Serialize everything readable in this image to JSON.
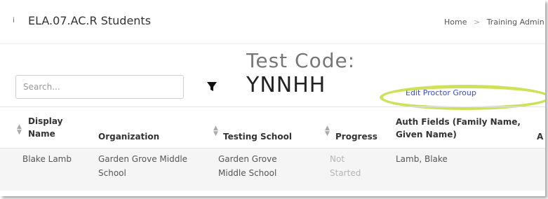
{
  "header": {
    "left_stub": "i",
    "title": "ELA.07.AC.R Students",
    "breadcrumb": [
      "Home",
      "Training Admin"
    ]
  },
  "toolbar": {
    "search_placeholder": "Search...",
    "filter_icon": "filter-icon",
    "test_code_label": "Test Code:",
    "test_code_value": "YNNHH",
    "edit_proctor_group_link": "Edit Proctor Group",
    "highlight_color": "#c6dc3a"
  },
  "table": {
    "columns": [
      "Display Name",
      "Organization",
      "Testing School",
      "Progress",
      "Auth Fields (Family Name, Given Name)",
      "A"
    ],
    "rows": [
      {
        "display_name": "Blake Lamb",
        "organization": "Garden Grove Middle School",
        "testing_school": "Garden Grove Middle School",
        "progress": "Not Started",
        "auth_fields": "Lamb, Blake"
      }
    ]
  }
}
